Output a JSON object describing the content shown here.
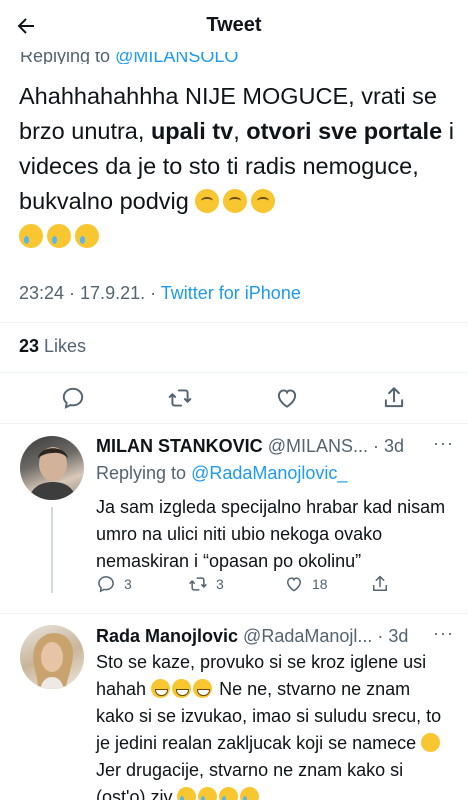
{
  "header": {
    "title": "Tweet",
    "back_icon": "arrow-left-icon"
  },
  "main_tweet": {
    "replying_prefix": "Replying to ",
    "replying_handle": "@MILANSOLO",
    "text_1": "Ahahhahahhha NIJE MOGUCE, vrati se brzo unutra, ",
    "bold_1": "upali tv",
    "text_2": ", ",
    "bold_2": "otvori sve portale",
    "text_3": " i videces da je to sto ti radis nemoguce, bukvalno podvig ",
    "timestamp": "23:24 · 17.9.21. · ",
    "source": "Twitter for iPhone",
    "likes_count": "23",
    "likes_label": " Likes"
  },
  "replies": [
    {
      "name": "MILAN STANKOVIC",
      "handle": "@MILANS...",
      "time": " · 3d",
      "more": "···",
      "replying_prefix": "Replying to ",
      "replying_handle": "@RadaManojlovic_",
      "text": "Ja sam izgleda specijalno hrabar kad nisam umro na ulici niti ubio nekoga ovako nemaskiran i “opasan po okolinu”",
      "reply_count": "3",
      "retweet_count": "3",
      "like_count": "18"
    },
    {
      "name": "Rada Manojlovic",
      "handle": "@RadaManojl...",
      "time": " · 3d",
      "more": "···",
      "text_1": "Sto se kaze, provuko si se kroz iglene usi hahah ",
      "text_2": " Ne ne, stvarno ne znam kako si se izvukao, imao si suludu srecu, to je jedini realan zakljucak koji se namece ",
      "text_3": " Jer drugacije, stvarno ne znam kako si (ost'o) ziv "
    }
  ],
  "colors": {
    "accent": "#1d9bf0",
    "secondary_text": "#536471",
    "divider": "#eff3f4"
  }
}
